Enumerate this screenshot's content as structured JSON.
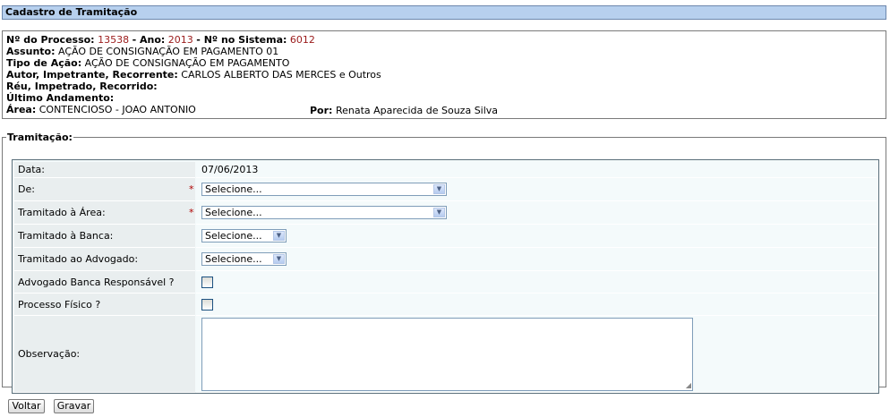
{
  "page_title": "Cadastro de Tramitação",
  "processo": {
    "numero_label": "Nº do Processo:",
    "numero_value": "13538",
    "ano_label": "Ano:",
    "ano_value": "2013",
    "sistema_label": "Nº no Sistema:",
    "sistema_value": "6012",
    "assunto_label": "Assunto:",
    "assunto_value": "AÇÃO DE CONSIGNAÇÃO EM PAGAMENTO 01",
    "tipo_label": "Tipo de Ação:",
    "tipo_value": "AÇÃO DE CONSIGNAÇÃO EM PAGAMENTO",
    "autor_label": "Autor, Impetrante, Recorrente:",
    "autor_value": "CARLOS ALBERTO DAS MERCES e Outros",
    "reu_label": "Réu, Impetrado, Recorrido:",
    "ultimo_label": "Último Andamento:",
    "area_label": "Área:",
    "area_value": "CONTENCIOSO - JOAO ANTONIO",
    "por_label": "Por:",
    "por_value": "Renata Aparecida de Souza Silva"
  },
  "tramitacao": {
    "legend": "Tramitação:",
    "data_label": "Data:",
    "data_value": "07/06/2013",
    "de_label": "De:",
    "de_value": "Selecione...",
    "area_label": "Tramitado à Área:",
    "area_value": "Selecione...",
    "banca_label": "Tramitado à Banca:",
    "banca_value": "Selecione...",
    "advogado_label": "Tramitado ao Advogado:",
    "advogado_value": "Selecione...",
    "adv_banca_label": "Advogado Banca Responsável ?",
    "fisico_label": "Processo Físico ?",
    "obs_label": "Observação:",
    "required_mark": "*"
  },
  "buttons": {
    "voltar": "Voltar",
    "gravar": "Gravar"
  }
}
